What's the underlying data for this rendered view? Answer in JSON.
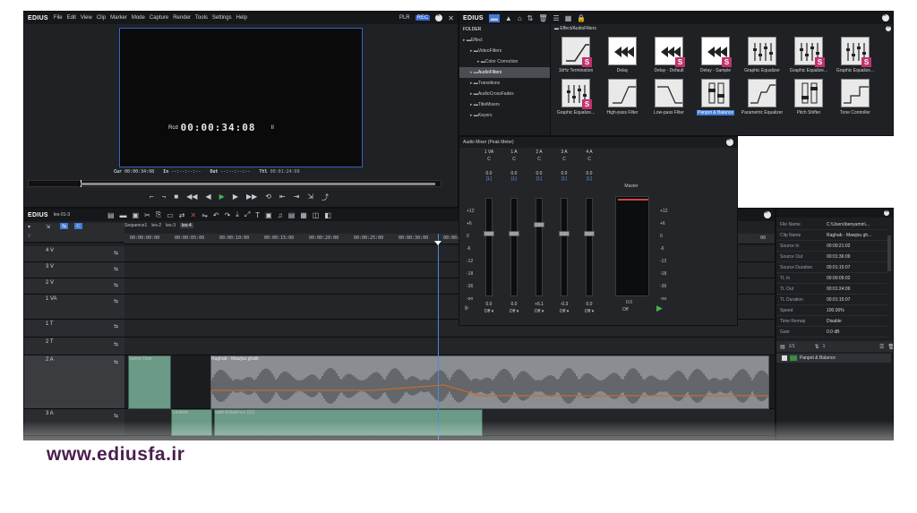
{
  "player": {
    "logo": "EDIUS",
    "menu": [
      "File",
      "Edit",
      "View",
      "Clip",
      "Marker",
      "Mode",
      "Capture",
      "Render",
      "Tools",
      "Settings",
      "Help"
    ],
    "mode_plr": "PLR",
    "mode_rec": "REC",
    "rec_label": "Rcd",
    "timecode": "00:00:34:08",
    "pause_glyph": "II",
    "cur_label": "Cur",
    "cur_value": "00:00:34:08",
    "in_label": "In",
    "in_value": "--:--:--:--",
    "out_label": "Out",
    "out_value": "--:--:--:--",
    "ttl_label": "Ttl",
    "ttl_value": "00:01:24:09"
  },
  "effects": {
    "logo": "EDIUS",
    "folder_header": "FOLDER",
    "path": "Effect/AudioFilters",
    "tree": [
      {
        "label": "Effect",
        "indent": 0
      },
      {
        "label": "VideoFilters",
        "indent": 1
      },
      {
        "label": "Color Correction",
        "indent": 2
      },
      {
        "label": "AudioFilters",
        "indent": 1,
        "selected": true
      },
      {
        "label": "Transitions",
        "indent": 1
      },
      {
        "label": "AudioCrossFades",
        "indent": 1
      },
      {
        "label": "TitleMixers",
        "indent": 1
      },
      {
        "label": "Keyers",
        "indent": 1
      }
    ],
    "items": [
      {
        "label": "1kHz Termination",
        "icon": "ramp-icon",
        "s": true
      },
      {
        "label": "Delay",
        "icon": "delay-icon",
        "s": false
      },
      {
        "label": "Delay - Default",
        "icon": "delay-icon",
        "s": true
      },
      {
        "label": "Delay - Sample",
        "icon": "delay-icon",
        "s": true
      },
      {
        "label": "Graphic Equalizer",
        "icon": "eq-icon",
        "s": false
      },
      {
        "label": "Graphic Equalize...",
        "icon": "eq-icon",
        "s": true
      },
      {
        "label": "Graphic Equalize...",
        "icon": "eq-icon",
        "s": true
      },
      {
        "label": "Graphic Equalize...",
        "icon": "eq-icon",
        "s": true
      },
      {
        "label": "High-pass Filter",
        "icon": "highpass-icon",
        "s": false
      },
      {
        "label": "Low-pass Filter",
        "icon": "lowpass-icon",
        "s": false
      },
      {
        "label": "Panpot & Balance",
        "icon": "panpot-icon",
        "s": false,
        "selected": true
      },
      {
        "label": "Parametric Equalizer",
        "icon": "param-icon",
        "s": false
      },
      {
        "label": "Pitch Shifter",
        "icon": "pitch-icon",
        "s": false
      },
      {
        "label": "Tone Controller",
        "icon": "tone-icon",
        "s": false
      }
    ]
  },
  "mixer": {
    "title": "Audio Mixer (Peak Meter)",
    "channels": [
      {
        "name": "1 VA",
        "pan": "C",
        "pan_value": "0.0",
        "link": "[L]",
        "gain": "0.0",
        "mode": "Off"
      },
      {
        "name": "1 A",
        "pan": "C",
        "pan_value": "0.0",
        "link": "[L]",
        "gain": "0.0",
        "mode": "Off"
      },
      {
        "name": "2 A",
        "pan": "C",
        "pan_value": "0.0",
        "link": "[L]",
        "gain": "+6.1",
        "mode": "Off"
      },
      {
        "name": "3 A",
        "pan": "C",
        "pan_value": "0.0",
        "link": "[L]",
        "gain": "-0.3",
        "mode": "Off"
      },
      {
        "name": "4 A",
        "pan": "C",
        "pan_value": "0.0",
        "link": "[L]",
        "gain": "0.0",
        "mode": "Off"
      }
    ],
    "master_label": "Master",
    "master_gain": "0.0",
    "master_mode": "Off",
    "scale": [
      "+12",
      "+6",
      "0",
      "-6",
      "-12",
      "-18",
      "-36",
      "-oo"
    ]
  },
  "timeline": {
    "logo": "EDIUS",
    "project": "les-01-3",
    "tabs": [
      "Sequence1",
      "les-2",
      "les-3",
      "les-4"
    ],
    "active_tab": "les-4",
    "ruler": [
      "00:00:00:00",
      "00:00:05:00",
      "00:00:10:00",
      "00:00:15:00",
      "00:00:20:00",
      "00:00:25:00",
      "00:00:30:00",
      "00:00:35:00"
    ],
    "ruler_tail": "00",
    "tracks": [
      {
        "name": "4 V",
        "type": "video"
      },
      {
        "name": "3 V",
        "type": "video"
      },
      {
        "name": "2 V",
        "type": "video"
      },
      {
        "name": "1 VA",
        "type": "va"
      },
      {
        "name": "1 T",
        "type": "title"
      },
      {
        "name": "2 T",
        "type": "title"
      },
      {
        "name": "2 A",
        "type": "audio"
      },
      {
        "name": "3 A",
        "type": "audio"
      }
    ],
    "clips": {
      "game_over": "Game Over",
      "raghab": "Raghab - Mawjou ghalb",
      "crickets": "Crickets",
      "walk": "walk-EdiusFa.ir (21)"
    },
    "track_label_v": "V",
    "track_label_a": "A"
  },
  "info": {
    "rows": [
      {
        "k": "File Name",
        "v": "C:\\Users\\benyamin\\..."
      },
      {
        "k": "Clip Name",
        "v": "Raghab - Mawjou gh..."
      },
      {
        "k": "Source In",
        "v": "00:00:21:02"
      },
      {
        "k": "Source Out",
        "v": "00:01:36:09"
      },
      {
        "k": "Source Duration",
        "v": "00:01:15:07"
      },
      {
        "k": "TL In",
        "v": "00:00:09:02"
      },
      {
        "k": "TL Out",
        "v": "00:01:24:09"
      },
      {
        "k": "TL Duration",
        "v": "00:01:15:07"
      },
      {
        "k": "Speed",
        "v": "100.00%"
      },
      {
        "k": "Time Remap",
        "v": "Disable"
      },
      {
        "k": "Gain",
        "v": "0.0 dB"
      }
    ],
    "page": "1/1",
    "page2": "1",
    "effect_item": "Panpot & Balance"
  },
  "watermark": "www.ediusfa.ir",
  "colors": {
    "accent": "#3f7bd8",
    "clip_green": "#6b9a86",
    "clip_gray": "#8a8d92",
    "watermark": "#4a1e4f",
    "envelope": "#c96a2a"
  }
}
